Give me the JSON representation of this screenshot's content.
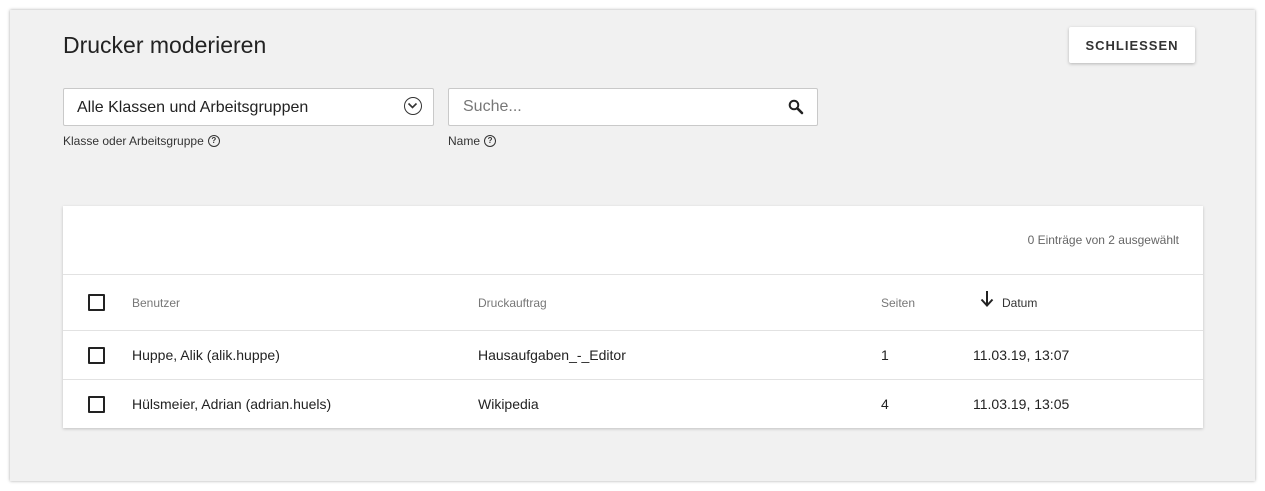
{
  "page": {
    "title": "Drucker moderieren",
    "close_label": "SCHLIESSEN"
  },
  "filters": {
    "group_select": {
      "value": "Alle Klassen und Arbeitsgruppen",
      "hint": "Klasse oder Arbeitsgruppe",
      "icon": "chevron-down-circle-icon"
    },
    "name_search": {
      "placeholder": "Suche...",
      "value": "",
      "hint": "Name",
      "icon": "search-icon"
    },
    "help_icon": "help-circle-icon"
  },
  "table": {
    "selection_count": "0 Einträge von 2 ausgewählt",
    "columns": {
      "user": "Benutzer",
      "job": "Druckauftrag",
      "pages": "Seiten",
      "date": "Datum"
    },
    "sort": {
      "column": "date",
      "direction": "descending",
      "icon": "arrow-down-icon"
    },
    "rows": [
      {
        "user": "Huppe, Alik (alik.huppe)",
        "job": "Hausaufgaben_-_Editor",
        "pages": "1",
        "date": "11.03.19, 13:07",
        "selected": false
      },
      {
        "user": "Hülsmeier, Adrian (adrian.huels)",
        "job": "Wikipedia",
        "pages": "4",
        "date": "11.03.19, 13:05",
        "selected": false
      }
    ]
  }
}
